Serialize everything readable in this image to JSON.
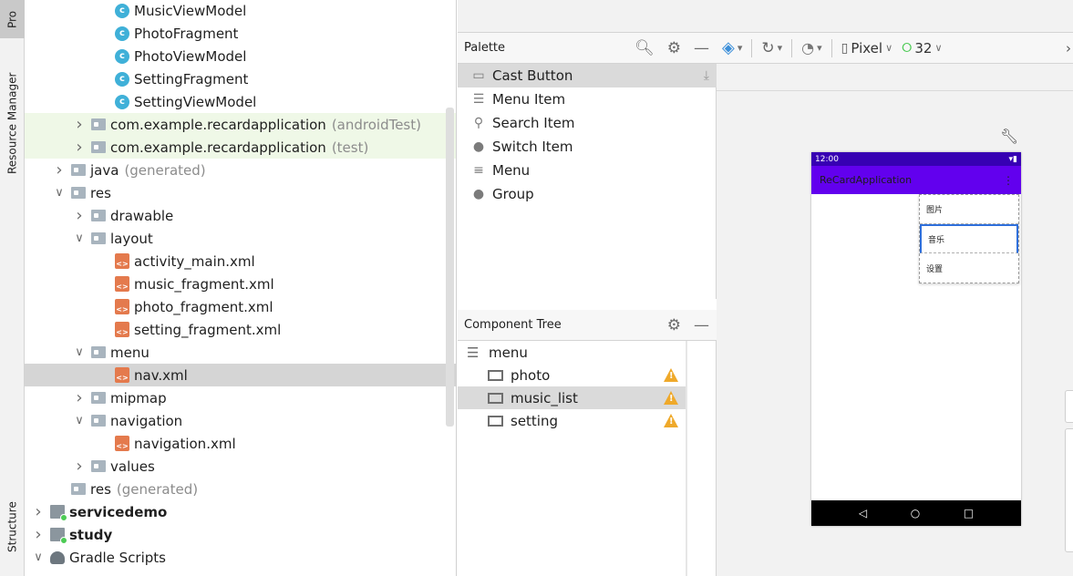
{
  "side_tabs": {
    "project": "Pro",
    "resource_manager": "Resource Manager",
    "structure": "Structure"
  },
  "tree": [
    {
      "label": "MusicViewModel",
      "muted": "",
      "icon": "class-icon",
      "indent": 3,
      "chev": ""
    },
    {
      "label": "PhotoFragment",
      "muted": "",
      "icon": "class-icon",
      "indent": 3,
      "chev": ""
    },
    {
      "label": "PhotoViewModel",
      "muted": "",
      "icon": "class-icon",
      "indent": 3,
      "chev": ""
    },
    {
      "label": "SettingFragment",
      "muted": "",
      "icon": "class-icon",
      "indent": 3,
      "chev": ""
    },
    {
      "label": "SettingViewModel",
      "muted": "",
      "icon": "class-icon",
      "indent": 3,
      "chev": ""
    },
    {
      "label": "com.example.recardapplication",
      "muted": "(androidTest)",
      "icon": "folder-icon",
      "indent": 2,
      "chev": "collapsed",
      "test": true
    },
    {
      "label": "com.example.recardapplication",
      "muted": "(test)",
      "icon": "folder-icon",
      "indent": 2,
      "chev": "collapsed",
      "test": true
    },
    {
      "label": "java",
      "muted": "(generated)",
      "icon": "folder-icon",
      "indent": 1,
      "chev": "collapsed"
    },
    {
      "label": "res",
      "muted": "",
      "icon": "folder-icon",
      "indent": 1,
      "chev": "expanded"
    },
    {
      "label": "drawable",
      "muted": "",
      "icon": "folder-icon",
      "indent": 2,
      "chev": "collapsed"
    },
    {
      "label": "layout",
      "muted": "",
      "icon": "folder-icon",
      "indent": 2,
      "chev": "expanded"
    },
    {
      "label": "activity_main.xml",
      "muted": "",
      "icon": "xml-icon",
      "indent": 3,
      "chev": ""
    },
    {
      "label": "music_fragment.xml",
      "muted": "",
      "icon": "xml-icon",
      "indent": 3,
      "chev": ""
    },
    {
      "label": "photo_fragment.xml",
      "muted": "",
      "icon": "xml-icon",
      "indent": 3,
      "chev": ""
    },
    {
      "label": "setting_fragment.xml",
      "muted": "",
      "icon": "xml-icon",
      "indent": 3,
      "chev": ""
    },
    {
      "label": "menu",
      "muted": "",
      "icon": "folder-icon",
      "indent": 2,
      "chev": "expanded"
    },
    {
      "label": "nav.xml",
      "muted": "",
      "icon": "xml-icon",
      "indent": 3,
      "chev": "",
      "selected": true
    },
    {
      "label": "mipmap",
      "muted": "",
      "icon": "folder-icon",
      "indent": 2,
      "chev": "collapsed"
    },
    {
      "label": "navigation",
      "muted": "",
      "icon": "folder-icon",
      "indent": 2,
      "chev": "expanded"
    },
    {
      "label": "navigation.xml",
      "muted": "",
      "icon": "xml-icon",
      "indent": 3,
      "chev": ""
    },
    {
      "label": "values",
      "muted": "",
      "icon": "folder-icon",
      "indent": 2,
      "chev": "collapsed"
    },
    {
      "label": "res",
      "muted": "(generated)",
      "icon": "folder-icon",
      "indent": 1,
      "chev": ""
    },
    {
      "label": "servicedemo",
      "muted": "",
      "icon": "module-icon",
      "indent": 0,
      "chev": "collapsed",
      "bold": true
    },
    {
      "label": "study",
      "muted": "",
      "icon": "module-icon",
      "indent": 0,
      "chev": "collapsed",
      "bold": true
    },
    {
      "label": "Gradle Scripts",
      "muted": "",
      "icon": "gradle-icon",
      "indent": 0,
      "chev": "expanded"
    }
  ],
  "palette": {
    "title": "Palette",
    "items": [
      {
        "label": "Cast Button",
        "icon": "cast-icon",
        "selected": true
      },
      {
        "label": "Menu Item",
        "icon": "menu-item-icon"
      },
      {
        "label": "Search Item",
        "icon": "search-icon"
      },
      {
        "label": "Switch Item",
        "icon": "switch-icon"
      },
      {
        "label": "Menu",
        "icon": "menu-icon"
      },
      {
        "label": "Group",
        "icon": "group-icon"
      }
    ]
  },
  "component_tree": {
    "title": "Component Tree",
    "root": "menu",
    "items": [
      {
        "label": "photo",
        "selected": false
      },
      {
        "label": "music_list",
        "selected": true
      },
      {
        "label": "setting",
        "selected": false
      }
    ]
  },
  "toolbar": {
    "device": "Pixel",
    "api_level": "32"
  },
  "preview": {
    "time": "12:00",
    "app_title": "ReCardApplication",
    "menu_items": [
      "图片",
      "音乐",
      "设置"
    ],
    "selected_menu_index": 1
  },
  "colors": {
    "status_bar": "#3700b3",
    "app_bar": "#6200ee",
    "selection": "#2e6fdb",
    "warning": "#efa92a",
    "android_green": "#4ccb54"
  }
}
